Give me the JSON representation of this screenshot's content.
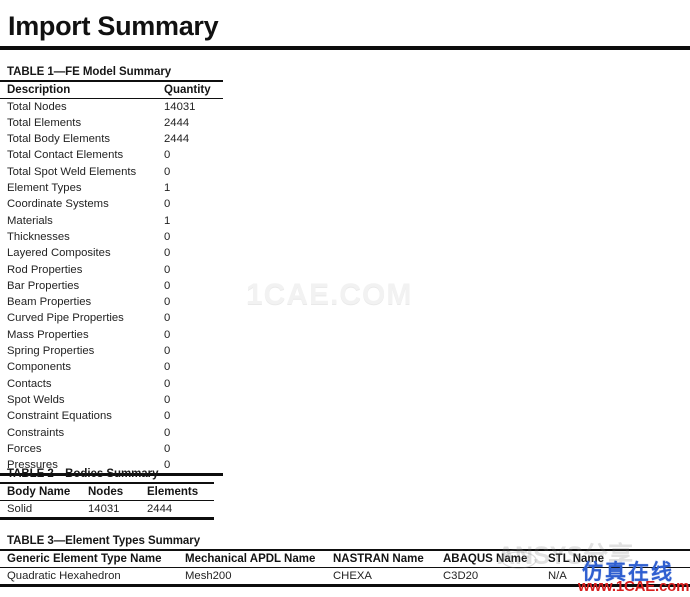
{
  "document": {
    "title": "Import Summary"
  },
  "table1": {
    "caption": "TABLE 1—FE Model Summary",
    "columns": [
      "Description",
      "Quantity"
    ],
    "rows": [
      [
        "Total Nodes",
        "14031"
      ],
      [
        "Total Elements",
        "2444"
      ],
      [
        "Total Body Elements",
        "2444"
      ],
      [
        "Total Contact Elements",
        "0"
      ],
      [
        "Total Spot Weld Elements",
        "0"
      ],
      [
        "Element Types",
        "1"
      ],
      [
        "Coordinate Systems",
        "0"
      ],
      [
        "Materials",
        "1"
      ],
      [
        "Thicknesses",
        "0"
      ],
      [
        "Layered Composites",
        "0"
      ],
      [
        "Rod Properties",
        "0"
      ],
      [
        "Bar Properties",
        "0"
      ],
      [
        "Beam Properties",
        "0"
      ],
      [
        "Curved Pipe Properties",
        "0"
      ],
      [
        "Mass Properties",
        "0"
      ],
      [
        "Spring Properties",
        "0"
      ],
      [
        "Components",
        "0"
      ],
      [
        "Contacts",
        "0"
      ],
      [
        "Spot Welds",
        "0"
      ],
      [
        "Constraint Equations",
        "0"
      ],
      [
        "Constraints",
        "0"
      ],
      [
        "Forces",
        "0"
      ],
      [
        "Pressures",
        "0"
      ]
    ]
  },
  "table2": {
    "caption": "TABLE 2—Bodies Summary",
    "columns": [
      "Body Name",
      "Nodes",
      "Elements"
    ],
    "rows": [
      [
        "Solid",
        "14031",
        "2444"
      ]
    ]
  },
  "table3": {
    "caption": "TABLE 3—Element Types Summary",
    "columns": [
      "Generic Element Type Name",
      "Mechanical APDL Name",
      "NASTRAN Name",
      "ABAQUS Name",
      "STL Name"
    ],
    "rows": [
      [
        "Quadratic Hexahedron",
        "Mesh200",
        "CHEXA",
        "C3D20",
        "N/A"
      ]
    ]
  },
  "watermarks": {
    "center": "1CAE.COM",
    "ghost": "ANSYS分享",
    "chinese": "仿真在线",
    "url": "www.1CAE.com",
    "center_color": "#f2f2f2",
    "chinese_color": "#2f5fd0",
    "url_color": "#d81d1d"
  }
}
